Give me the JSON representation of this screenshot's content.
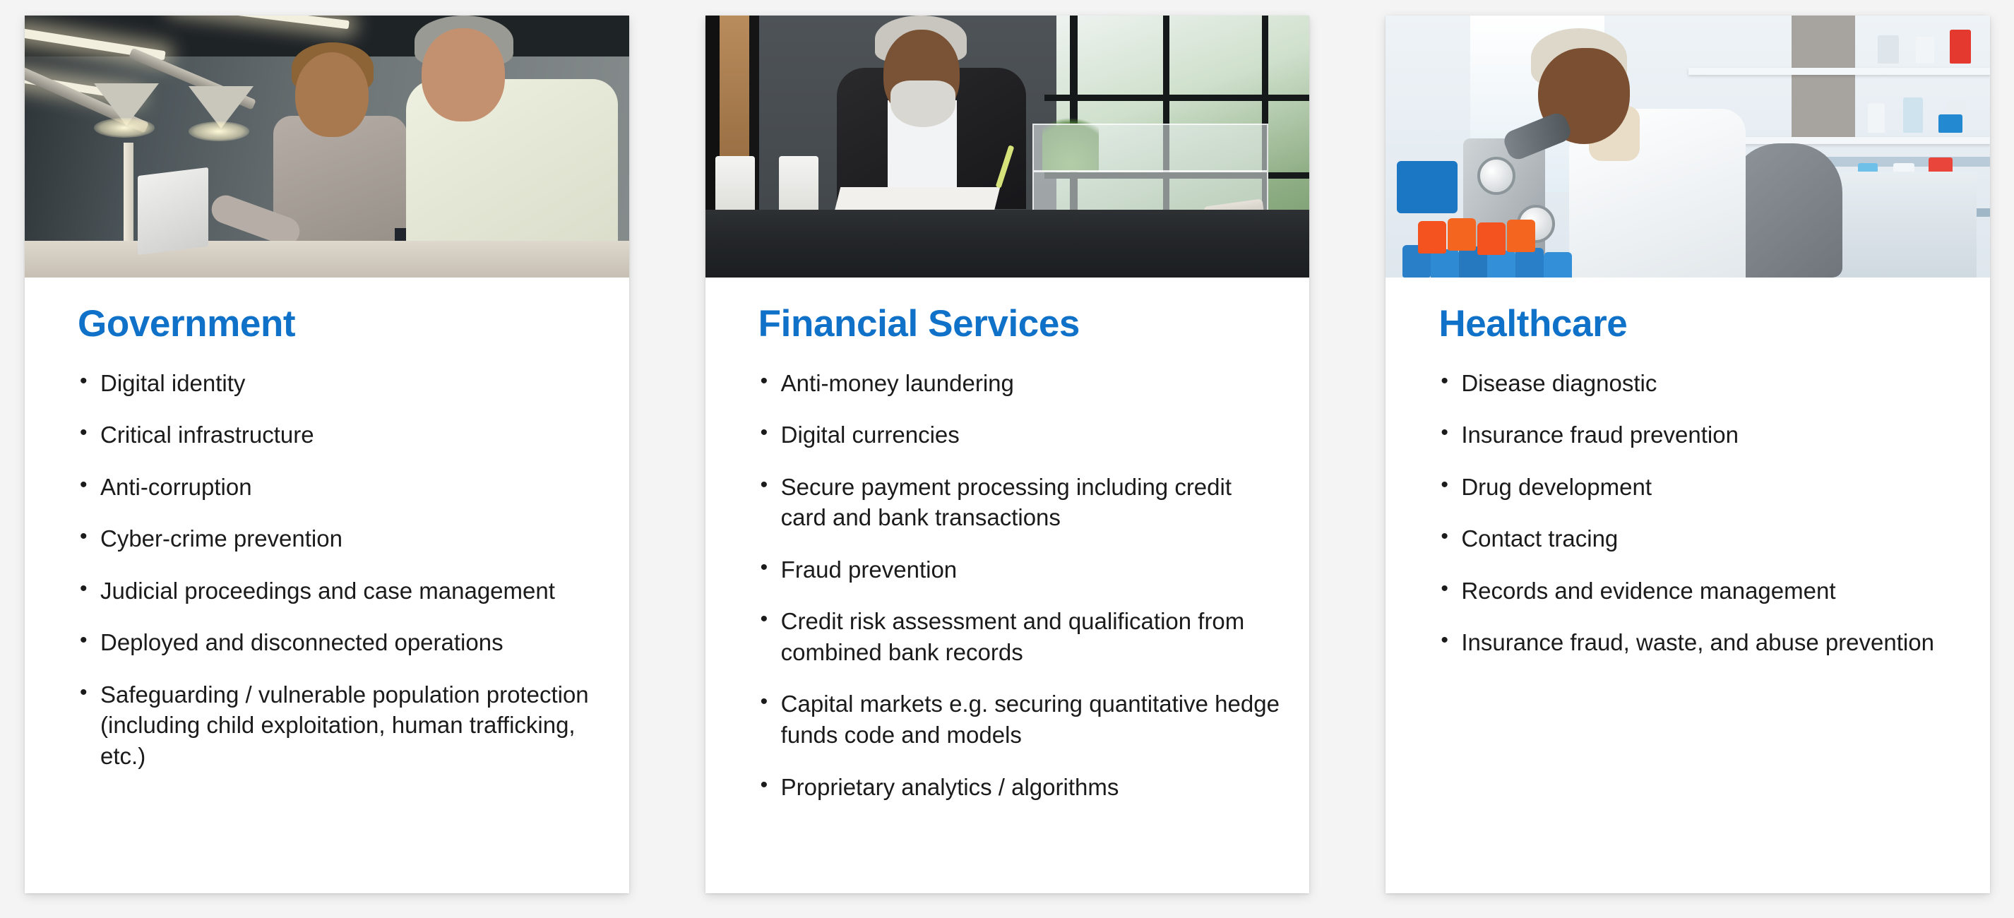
{
  "page": {
    "background_color": "#f4f4f4",
    "accent_color": "#1071c8",
    "text_color": "#1b1b1b"
  },
  "cards": [
    {
      "id": "government",
      "title": "Government",
      "photo_alt": "Two colleagues reviewing a laptop at a workbench under desk lamps",
      "bullets": [
        "Digital identity",
        "Critical infrastructure",
        "Anti-corruption",
        "Cyber-crime prevention",
        "Judicial proceedings and case management",
        "Deployed and disconnected operations",
        "Safeguarding / vulnerable population protection (including child exploitation, human trafficking, etc.)"
      ]
    },
    {
      "id": "financial-services",
      "title": "Financial Services",
      "photo_alt": "Businessman at a desk reviewing a document next to a window",
      "bullets": [
        "Anti-money laundering",
        "Digital currencies",
        "Secure payment processing including credit card and bank transactions",
        "Fraud prevention",
        "Credit risk assessment and qualification from combined bank records",
        "Capital markets e.g. securing quantitative hedge funds code and models",
        "Proprietary analytics / algorithms"
      ]
    },
    {
      "id": "healthcare",
      "title": "Healthcare",
      "photo_alt": "Scientist in a white lab coat looking through a microscope in a laboratory",
      "bullets": [
        "Disease diagnostic",
        "Insurance fraud prevention",
        "Drug development",
        "Contact tracing",
        "Records and evidence management",
        "Insurance fraud, waste, and abuse prevention"
      ]
    }
  ]
}
